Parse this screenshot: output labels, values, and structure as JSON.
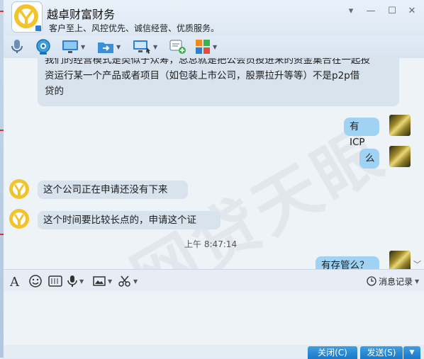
{
  "app": {
    "title": "越卓财富财务",
    "subtitle": "客户至上、风控优先、诚信经营、优质服务。",
    "colors": {
      "accent": "#1a78c9",
      "outgoing": "#9fd2f3",
      "incoming": "#d9e3ee",
      "logo_yellow": "#f2c32a"
    }
  },
  "window_controls": [
    {
      "icon": "dropdown-icon",
      "glyph": "▾"
    },
    {
      "icon": "minimize-icon",
      "glyph": "—"
    },
    {
      "icon": "maximize-icon",
      "glyph": "☐"
    },
    {
      "icon": "close-icon",
      "glyph": "✕"
    }
  ],
  "toolbar": {
    "items": [
      "voice-call-icon",
      "video-call-icon",
      "remote-desktop-icon",
      "send-file-icon",
      "screen-share-icon",
      "send-sms-icon",
      "apps-icon"
    ]
  },
  "chat": {
    "messages": [
      {
        "dir": "in",
        "text_line1": "我们的经营模式是类似于众筹，总总就是把公会员投进来的资金集合在一起投",
        "text_line2": "资运行某一个产品或者项目（如包装上市公司，股票拉升等等）不是p2p借",
        "text_line3": "贷的"
      },
      {
        "dir": "out",
        "text": "有ICP"
      },
      {
        "dir": "out",
        "text": "么"
      },
      {
        "dir": "in",
        "text": "这个公司正在申请还没有下来"
      },
      {
        "dir": "in",
        "text": "这个时间要比较长点的，申请这个证"
      },
      {
        "dir": "out",
        "text": "有存管么？"
      }
    ],
    "timestamp": "上午 8:47:14"
  },
  "input_toolbar": {
    "items": [
      "font-icon",
      "emoji-icon",
      "gif-icon",
      "microphone-icon",
      "image-icon",
      "scissors-icon"
    ],
    "history_label": "消息记录"
  },
  "buttons": {
    "close": "关闭(C)",
    "send": "发送(S)"
  }
}
